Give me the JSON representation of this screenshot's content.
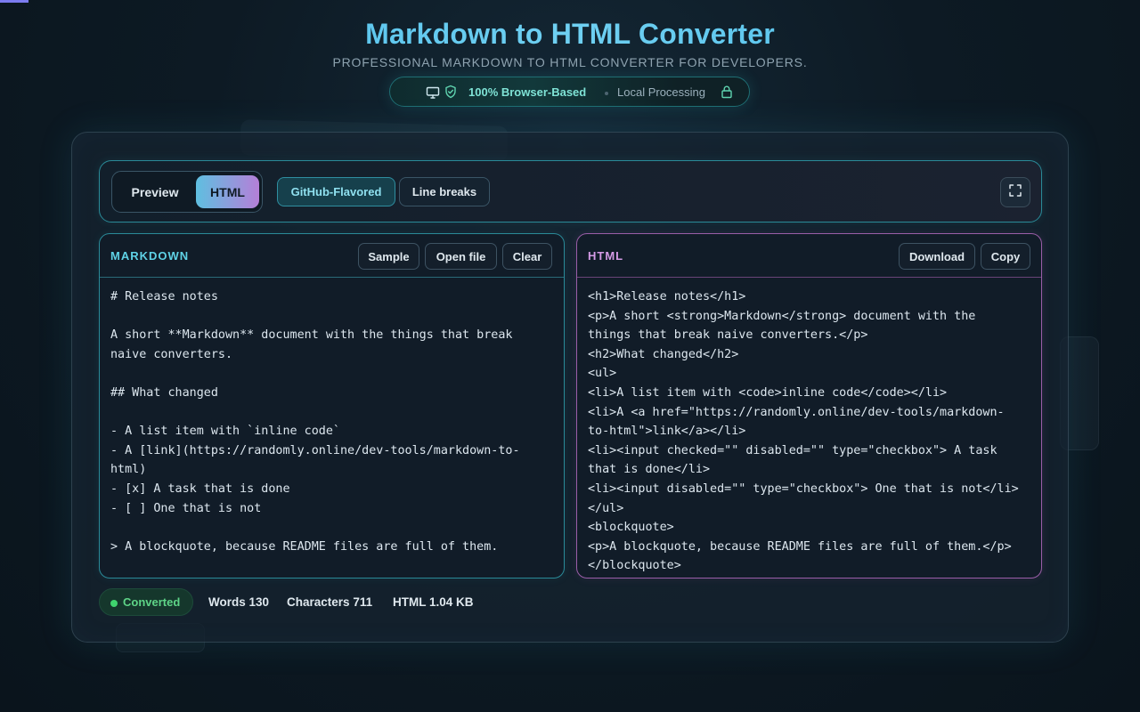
{
  "header": {
    "title": "Markdown to HTML Converter",
    "subtitle": "PROFESSIONAL MARKDOWN TO HTML CONVERTER FOR DEVELOPERS.",
    "pill_strong": "100% Browser-Based",
    "pill_local": "Local Processing"
  },
  "toolbar": {
    "mode_preview": "Preview",
    "mode_html": "HTML",
    "mode_selected": "HTML",
    "option_github": "GitHub-Flavored",
    "option_linebreaks": "Line breaks"
  },
  "markdown_panel": {
    "label": "MARKDOWN",
    "sample_button": "Sample",
    "open_button": "Open file",
    "clear_button": "Clear",
    "content": "# Release notes\n\nA short **Markdown** document with the things that break\nnaive converters.\n\n## What changed\n\n- A list item with `inline code`\n- A [link](https://randomly.online/dev-tools/markdown-to-\nhtml)\n- [x] A task that is done\n- [ ] One that is not\n\n> A blockquote, because README files are full of them."
  },
  "html_panel": {
    "label": "HTML",
    "download_button": "Download",
    "copy_button": "Copy",
    "content": "<h1>Release notes</h1>\n<p>A short <strong>Markdown</strong> document with the\nthings that break naive converters.</p>\n<h2>What changed</h2>\n<ul>\n<li>A list item with <code>inline code</code></li>\n<li>A <a href=\"https://randomly.online/dev-tools/markdown-\nto-html\">link</a></li>\n<li><input checked=\"\" disabled=\"\" type=\"checkbox\"> A task\nthat is done</li>\n<li><input disabled=\"\" type=\"checkbox\"> One that is not</li>\n</ul>\n<blockquote>\n<p>A blockquote, because README files are full of them.</p>\n</blockquote>"
  },
  "status": {
    "badge": "Converted",
    "words_label": "Words",
    "words_value": "130",
    "chars_label": "Characters",
    "chars_value": "711",
    "html_label": "HTML",
    "html_value": "1.04 KB"
  },
  "icons": {
    "pill_monitor": "monitor-icon",
    "pill_shield": "shield-check-icon",
    "pill_lock": "lock-icon",
    "expand": "expand-icon"
  },
  "colors": {
    "title_accent": "#43b9e8",
    "markdown_accent": "#5fd2e6",
    "html_accent": "#d59be6",
    "success": "#3fd46e"
  }
}
